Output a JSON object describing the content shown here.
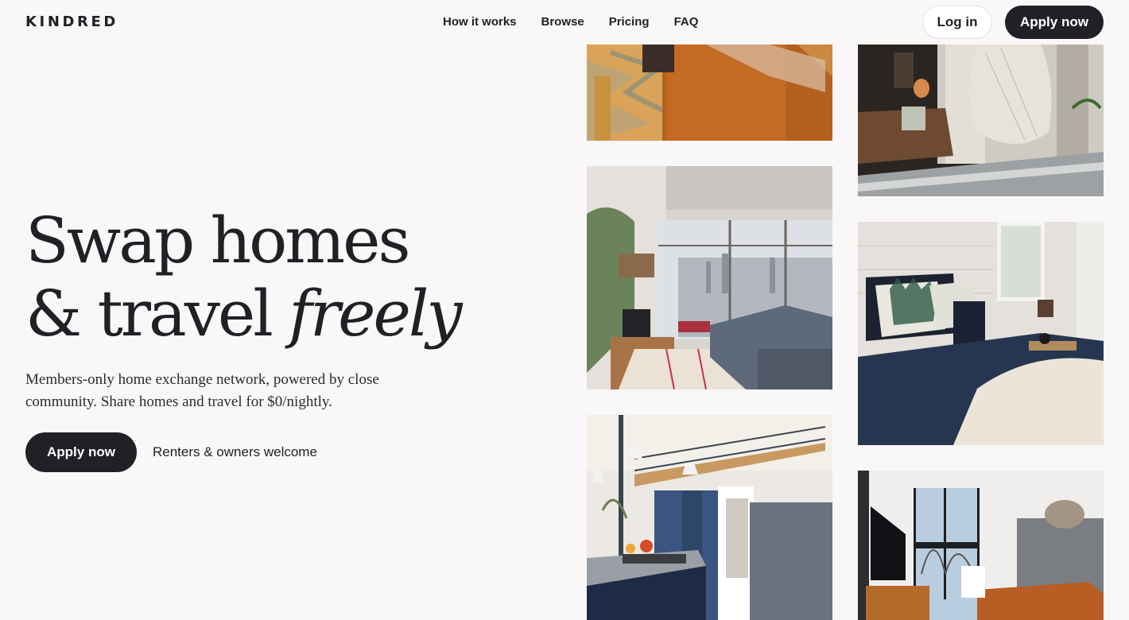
{
  "brand": {
    "logo": "KINDRED"
  },
  "nav": {
    "items": [
      {
        "label": "How it works"
      },
      {
        "label": "Browse"
      },
      {
        "label": "Pricing"
      },
      {
        "label": "FAQ"
      }
    ],
    "login_label": "Log in",
    "apply_label": "Apply now"
  },
  "hero": {
    "title_line1": "Swap homes",
    "title_line2_plain": "& travel ",
    "title_line2_italic": "freely",
    "subtitle": "Members-only home exchange network, powered by close community. Share homes and travel for $0/nightly.",
    "cta_label": "Apply now",
    "note": "Renters & owners welcome"
  },
  "gallery": {
    "photos": [
      {
        "subject": "leather sofa on patterned rug"
      },
      {
        "subject": "living room with city window view"
      },
      {
        "subject": "loft kitchen with blue cabinets"
      },
      {
        "subject": "hanging hammock chair by window"
      },
      {
        "subject": "bedroom with pine-tree pillows"
      },
      {
        "subject": "double-height living room with leather sofa"
      }
    ]
  },
  "colors": {
    "background": "#f9f7f7",
    "text": "#1f2126",
    "primary_button": "#1f2126",
    "primary_button_text": "#ffffff"
  }
}
